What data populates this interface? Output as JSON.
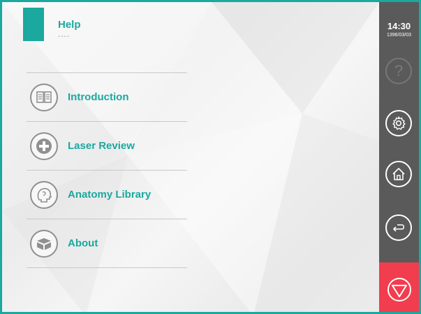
{
  "header": {
    "title": "Help",
    "subtitle": "----"
  },
  "menu": {
    "items": [
      {
        "label": "Introduction",
        "icon": "book-icon"
      },
      {
        "label": "Laser Review",
        "icon": "plus-icon"
      },
      {
        "label": "Anatomy Library",
        "icon": "head-icon"
      },
      {
        "label": "About",
        "icon": "box-icon"
      }
    ]
  },
  "status": {
    "time": "14:30",
    "date": "1396/03/03"
  },
  "sidebar": {
    "buttons": [
      {
        "icon": "question-icon",
        "label": "?",
        "enabled": false
      },
      {
        "icon": "gear-icon",
        "enabled": true
      },
      {
        "icon": "home-icon",
        "enabled": true
      },
      {
        "icon": "back-arrow-icon",
        "enabled": true
      },
      {
        "icon": "stop-icon",
        "enabled": true
      }
    ]
  },
  "colors": {
    "accent": "#1aa89f",
    "sidebar": "#5a5a5a",
    "stop": "#f23d4f",
    "menu_icon": "#8f8f8f"
  }
}
